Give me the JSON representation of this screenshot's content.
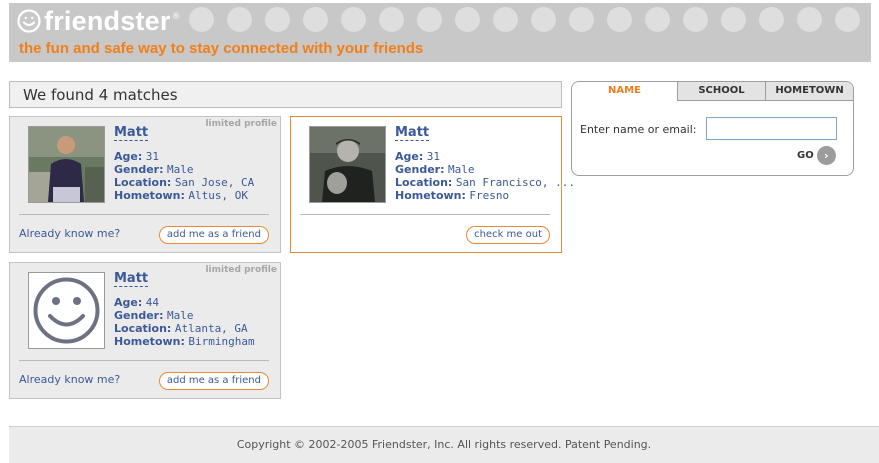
{
  "brand": {
    "logo_text": "friendster",
    "logo_tm": "®",
    "tagline": "the fun and safe way to stay connected with your friends",
    "accent_color": "#f07f1b"
  },
  "results": {
    "title": "We found 4 matches"
  },
  "profiles": [
    {
      "badge": "limited profile",
      "name": "Matt",
      "age_label": "Age:",
      "age": "31",
      "gender_label": "Gender:",
      "gender": "Male",
      "location_label": "Location:",
      "location": "San Jose, CA",
      "hometown_label": "Hometown:",
      "hometown": "Altus, OK",
      "prompt": "Already know me?",
      "action": "add me as a friend"
    },
    {
      "name": "Matt",
      "age_label": "Age:",
      "age": "31",
      "gender_label": "Gender:",
      "gender": "Male",
      "location_label": "Location:",
      "location": "San Francisco, ...",
      "hometown_label": "Hometown:",
      "hometown": "Fresno",
      "action": "check me out"
    },
    {
      "badge": "limited profile",
      "name": "Matt",
      "age_label": "Age:",
      "age": "44",
      "gender_label": "Gender:",
      "gender": "Male",
      "location_label": "Location:",
      "location": "Atlanta, GA",
      "hometown_label": "Hometown:",
      "hometown": "Birmingham",
      "prompt": "Already know me?",
      "action": "add me as a friend"
    }
  ],
  "search": {
    "tabs": [
      "NAME",
      "SCHOOL",
      "HOMETOWN"
    ],
    "active_tab": "NAME",
    "field_label": "Enter name or email:",
    "field_value": "",
    "go_label": "GO",
    "go_icon": "arrow-right-icon"
  },
  "footer": {
    "copyright": "Copyright © 2002-2005 Friendster, Inc. All rights reserved. Patent Pending."
  }
}
